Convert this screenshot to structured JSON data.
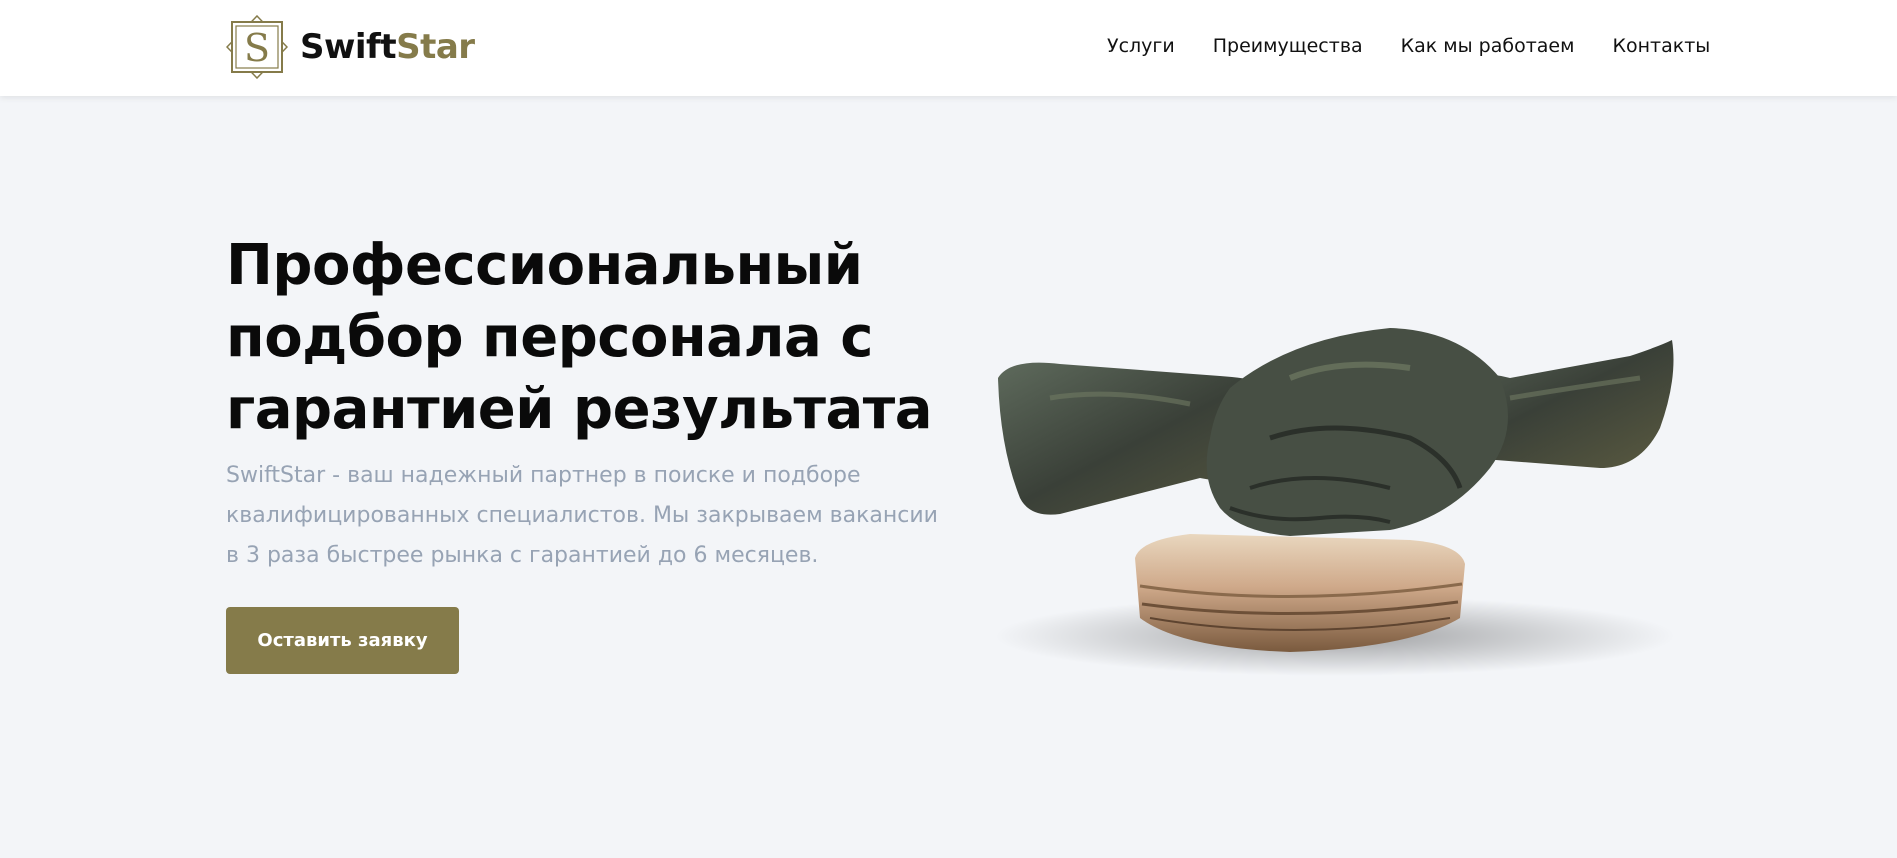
{
  "brand": {
    "name_part1": "Swift",
    "name_part2": "Star",
    "mark_letter": "S",
    "accent_color": "#857b4a"
  },
  "nav": {
    "items": [
      {
        "label": "Услуги"
      },
      {
        "label": "Преимущества"
      },
      {
        "label": "Как мы работаем"
      },
      {
        "label": "Контакты"
      }
    ]
  },
  "hero": {
    "title": "Профессиональный подбор персонала с гарантией результата",
    "subtitle": "SwiftStar - ваш надежный партнер в поиске и подборе квалифицированных специалистов. Мы закрываем вакансии в 3 раза быстрее рынка с гарантией до 6 месяцев.",
    "cta_label": "Оставить заявку",
    "image_subject": "handshake-sculpture"
  }
}
